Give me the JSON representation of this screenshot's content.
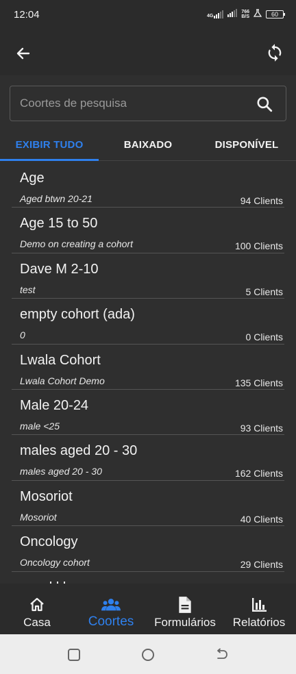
{
  "status_bar": {
    "time": "12:04",
    "network": "4G",
    "speed_value": "766",
    "speed_unit": "B/S",
    "battery": "60"
  },
  "search": {
    "placeholder": "Coortes de pesquisa"
  },
  "tabs": [
    {
      "label": "EXIBIR TUDO",
      "active": true
    },
    {
      "label": "BAIXADO",
      "active": false
    },
    {
      "label": "DISPONÍVEL",
      "active": false
    }
  ],
  "cohorts": [
    {
      "name": "Age",
      "description": "Aged btwn 20-21",
      "count": "94 Clients"
    },
    {
      "name": "Age 15 to 50",
      "description": "Demo on creating a cohort",
      "count": "100 Clients"
    },
    {
      "name": "Dave M 2-10",
      "description": "test",
      "count": "5 Clients"
    },
    {
      "name": "empty cohort (ada)",
      "description": "0",
      "count": "0 Clients"
    },
    {
      "name": "Lwala Cohort",
      "description": "Lwala Cohort Demo",
      "count": "135 Clients"
    },
    {
      "name": "Male 20-24",
      "description": "male <25",
      "count": "93 Clients"
    },
    {
      "name": "males aged 20 - 30",
      "description": "males aged 20 - 30",
      "count": "162 Clients"
    },
    {
      "name": "Mosoriot",
      "description": "Mosoriot",
      "count": "40 Clients"
    },
    {
      "name": "Oncology",
      "description": "Oncology cohort",
      "count": "29 Clients"
    }
  ],
  "bottom_nav": [
    {
      "label": "Casa",
      "icon": "home-icon",
      "active": false
    },
    {
      "label": "Coortes",
      "icon": "people-icon",
      "active": true
    },
    {
      "label": "Formulários",
      "icon": "document-icon",
      "active": false
    },
    {
      "label": "Relatórios",
      "icon": "bar-chart-icon",
      "active": false
    }
  ],
  "colors": {
    "accent": "#2f80ed",
    "background": "#2f2f2f",
    "bar": "#2b2b2b"
  }
}
